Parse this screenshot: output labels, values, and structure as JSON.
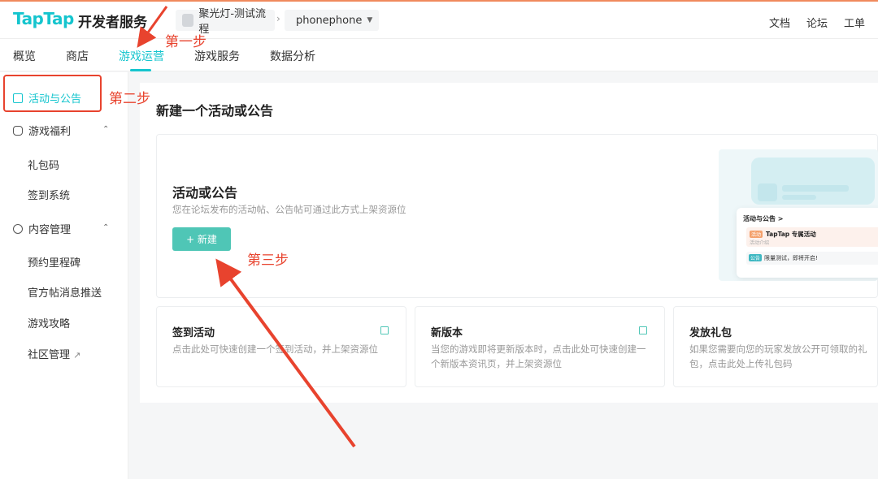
{
  "topbar": {
    "logo": "TapTap",
    "logo_sub": "开发者服务",
    "breadcrumb_project": "聚光灯-测试流程",
    "breadcrumb_separator": "›",
    "breadcrumb_game": "phonephone",
    "links": [
      "文档",
      "论坛",
      "工单"
    ]
  },
  "subnav": {
    "tabs": [
      "概览",
      "商店",
      "游戏运营",
      "游戏服务",
      "数据分析"
    ],
    "active_tab": "游戏运营"
  },
  "annotations": {
    "step1": "第一步",
    "step2": "第二步",
    "step3": "第三步",
    "color": "#e8432e"
  },
  "sidebar": {
    "active": "活动与公告",
    "groups": [
      {
        "label": "游戏福利",
        "items": [
          "礼包码",
          "签到系统"
        ]
      },
      {
        "label": "内容管理",
        "items": [
          "预约里程碑",
          "官方帖消息推送",
          "游戏攻略",
          "社区管理"
        ]
      }
    ]
  },
  "main": {
    "title": "新建一个活动或公告",
    "big_card": {
      "title": "活动或公告",
      "desc": "您在论坛发布的活动帖、公告帖可通过此方式上架资源位",
      "button": "+ 新建"
    },
    "illustration": {
      "header": "活动与公告 >",
      "tag1": "活动",
      "item_name": "TapTap 专属活动",
      "item_intro": "活动介绍",
      "tag2": "公告",
      "item2": "限量测试，即将开启!"
    },
    "cards": [
      {
        "title": "签到活动",
        "desc": "点击此处可快速创建一个签到活动，并上架资源位"
      },
      {
        "title": "新版本",
        "desc": "当您的游戏即将更新版本时，点击此处可快速创建一个新版本资讯页，并上架资源位"
      },
      {
        "title": "发放礼包",
        "desc": "如果您需要向您的玩家发放公开可领取的礼包，点击此处上传礼包码"
      }
    ]
  },
  "colors": {
    "accent": "#15c5ce",
    "button": "#4fc6b6",
    "annotation": "#e8432e"
  }
}
